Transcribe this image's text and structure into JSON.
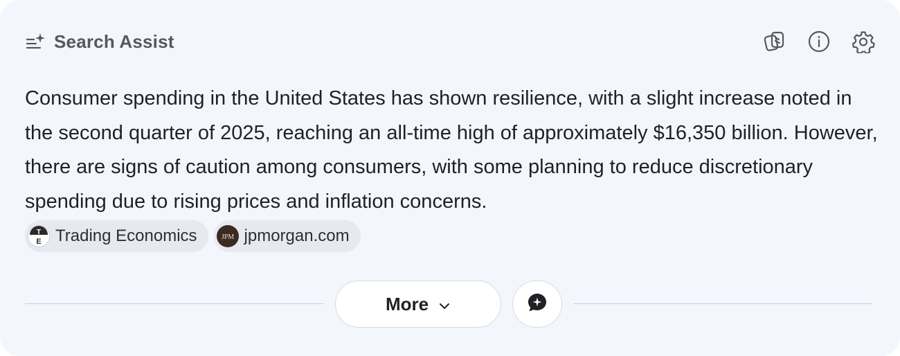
{
  "header": {
    "title": "Search Assist",
    "icons": [
      "sparkle-list-icon",
      "copy-icon",
      "info-icon",
      "gear-icon"
    ]
  },
  "summary": {
    "text": "Consumer spending in the United States has shown resilience, with a slight increase noted in the second quarter of 2025, reaching an all-time high of approximately $16,350 billion. However, there are signs of caution among consumers, with some planning to reduce discretionary spending due to rising prices and inflation concerns."
  },
  "sources": [
    {
      "label": "Trading Economics",
      "logo_text_top": "T",
      "logo_text_bottom": "E"
    },
    {
      "label": "jpmorgan.com",
      "logo_text": "JPM"
    }
  ],
  "footer": {
    "more_label": "More",
    "more_icon": "chevron-down-icon",
    "feedback_icon": "chat-sparkle-icon"
  },
  "colors": {
    "card_background": "#f3f6fc",
    "chip_background": "#e6e9f0",
    "text_primary": "#1f2124",
    "text_title": "#55595e"
  }
}
